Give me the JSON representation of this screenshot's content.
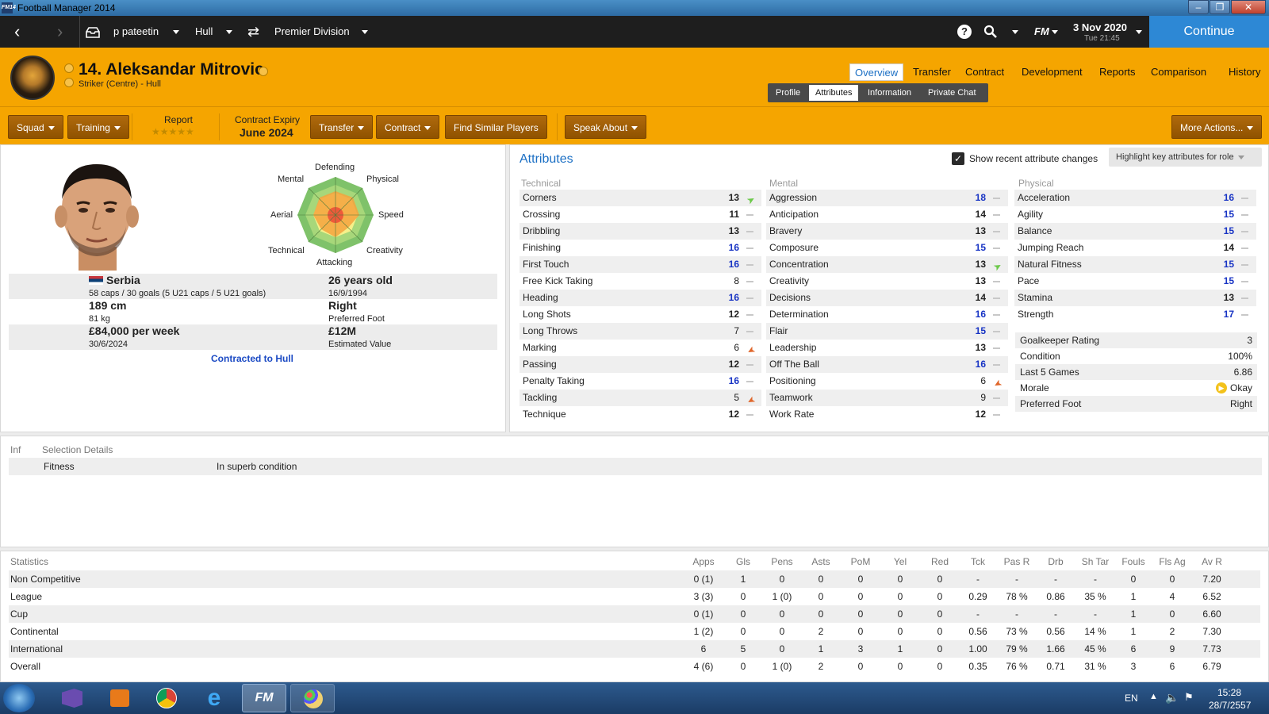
{
  "window": {
    "title": "Football Manager 2014",
    "app_icon": "FM14"
  },
  "topbar": {
    "manager": "p pateetin",
    "club": "Hull",
    "competition": "Premier Division",
    "date": "3 Nov 2020",
    "time": "Tue 21:45",
    "fm_label": "FM",
    "continue_label": "Continue"
  },
  "player": {
    "number_name": "14. Aleksandar Mitrovic",
    "position": "Striker (Centre) - Hull"
  },
  "nav": {
    "tabs": [
      "Overview",
      "Transfer",
      "Contract",
      "Development",
      "Reports",
      "Comparison",
      "History"
    ],
    "active": "Overview",
    "subtabs": [
      "Profile",
      "Attributes",
      "Information",
      "Private Chat"
    ],
    "active_sub": "Attributes"
  },
  "actions": {
    "squad": "Squad",
    "training": "Training",
    "report_label": "Report",
    "report_stars": "★★★★★",
    "contract_expiry_label": "Contract Expiry",
    "contract_expiry_value": "June 2024",
    "transfer": "Transfer",
    "contract": "Contract",
    "find_similar": "Find Similar Players",
    "speak_about": "Speak About",
    "more_actions": "More Actions..."
  },
  "radar": {
    "labels": [
      "Defending",
      "Physical",
      "Speed",
      "Creativity",
      "Attacking",
      "Technical",
      "Aerial",
      "Mental"
    ]
  },
  "profile": {
    "nation": "Serbia",
    "caps": "58 caps / 30 goals (5 U21 caps / 5 U21 goals)",
    "age": "26 years old",
    "dob": "16/9/1994",
    "height": "189 cm",
    "weight": "81 kg",
    "foot": "Right",
    "foot_label": "Preferred Foot",
    "wage": "£84,000 per week",
    "wage_date": "30/6/2024",
    "value": "£12M",
    "value_label": "Estimated Value",
    "contracted": "Contracted to Hull"
  },
  "attributes": {
    "title": "Attributes",
    "show_changes": "Show recent attribute changes",
    "highlight": "Highlight key attributes for role",
    "technical_label": "Technical",
    "mental_label": "Mental",
    "physical_label": "Physical",
    "technical": [
      [
        "Corners",
        13,
        "up"
      ],
      [
        "Crossing",
        11,
        ""
      ],
      [
        "Dribbling",
        13,
        ""
      ],
      [
        "Finishing",
        16,
        ""
      ],
      [
        "First Touch",
        16,
        ""
      ],
      [
        "Free Kick Taking",
        8,
        ""
      ],
      [
        "Heading",
        16,
        ""
      ],
      [
        "Long Shots",
        12,
        ""
      ],
      [
        "Long Throws",
        7,
        ""
      ],
      [
        "Marking",
        6,
        "down"
      ],
      [
        "Passing",
        12,
        ""
      ],
      [
        "Penalty Taking",
        16,
        ""
      ],
      [
        "Tackling",
        5,
        "down"
      ],
      [
        "Technique",
        12,
        ""
      ]
    ],
    "mental": [
      [
        "Aggression",
        18,
        ""
      ],
      [
        "Anticipation",
        14,
        ""
      ],
      [
        "Bravery",
        13,
        ""
      ],
      [
        "Composure",
        15,
        ""
      ],
      [
        "Concentration",
        13,
        "up"
      ],
      [
        "Creativity",
        13,
        ""
      ],
      [
        "Decisions",
        14,
        ""
      ],
      [
        "Determination",
        16,
        ""
      ],
      [
        "Flair",
        15,
        ""
      ],
      [
        "Leadership",
        13,
        ""
      ],
      [
        "Off The Ball",
        16,
        ""
      ],
      [
        "Positioning",
        6,
        "down"
      ],
      [
        "Teamwork",
        9,
        ""
      ],
      [
        "Work Rate",
        12,
        ""
      ]
    ],
    "physical": [
      [
        "Acceleration",
        16,
        ""
      ],
      [
        "Agility",
        15,
        ""
      ],
      [
        "Balance",
        15,
        ""
      ],
      [
        "Jumping Reach",
        14,
        ""
      ],
      [
        "Natural Fitness",
        15,
        ""
      ],
      [
        "Pace",
        15,
        ""
      ],
      [
        "Stamina",
        13,
        ""
      ],
      [
        "Strength",
        17,
        ""
      ]
    ]
  },
  "summary": [
    [
      "Goalkeeper Rating",
      "3"
    ],
    [
      "Condition",
      "100%"
    ],
    [
      "Last 5 Games",
      "6.86"
    ],
    [
      "Morale",
      "Okay"
    ],
    [
      "Preferred Foot",
      "Right"
    ]
  ],
  "selection": {
    "inf": "Inf",
    "title": "Selection Details",
    "fitness_label": "Fitness",
    "fitness_value": "In superb condition"
  },
  "stats": {
    "title": "Statistics",
    "headers": [
      "Apps",
      "Gls",
      "Pens",
      "Asts",
      "PoM",
      "Yel",
      "Red",
      "Tck",
      "Pas R",
      "Drb",
      "Sh Tar",
      "Fouls",
      "Fls Ag",
      "Av R"
    ],
    "rows": [
      [
        "Non Competitive",
        "0 (1)",
        "1",
        "0",
        "0",
        "0",
        "0",
        "0",
        "-",
        "-",
        "-",
        "-",
        "0",
        "0",
        "7.20"
      ],
      [
        "League",
        "3 (3)",
        "0",
        "1 (0)",
        "0",
        "0",
        "0",
        "0",
        "0.29",
        "78 %",
        "0.86",
        "35 %",
        "1",
        "4",
        "6.52"
      ],
      [
        "Cup",
        "0 (1)",
        "0",
        "0",
        "0",
        "0",
        "0",
        "0",
        "-",
        "-",
        "-",
        "-",
        "1",
        "0",
        "6.60"
      ],
      [
        "Continental",
        "1 (2)",
        "0",
        "0",
        "2",
        "0",
        "0",
        "0",
        "0.56",
        "73 %",
        "0.56",
        "14 %",
        "1",
        "2",
        "7.30"
      ],
      [
        "International",
        "6",
        "5",
        "0",
        "1",
        "3",
        "1",
        "0",
        "1.00",
        "79 %",
        "1.66",
        "45 %",
        "6",
        "9",
        "7.73"
      ],
      [
        "Overall",
        "4 (6)",
        "0",
        "1 (0)",
        "2",
        "0",
        "0",
        "0",
        "0.35",
        "76 %",
        "0.71",
        "31 %",
        "3",
        "6",
        "6.79"
      ]
    ]
  },
  "taskbar": {
    "lang": "EN",
    "clock": "15:28",
    "date": "28/7/2557"
  },
  "colors": {
    "orange": "#f5a500",
    "high": "#1834c4",
    "continue": "#2d88d5"
  }
}
